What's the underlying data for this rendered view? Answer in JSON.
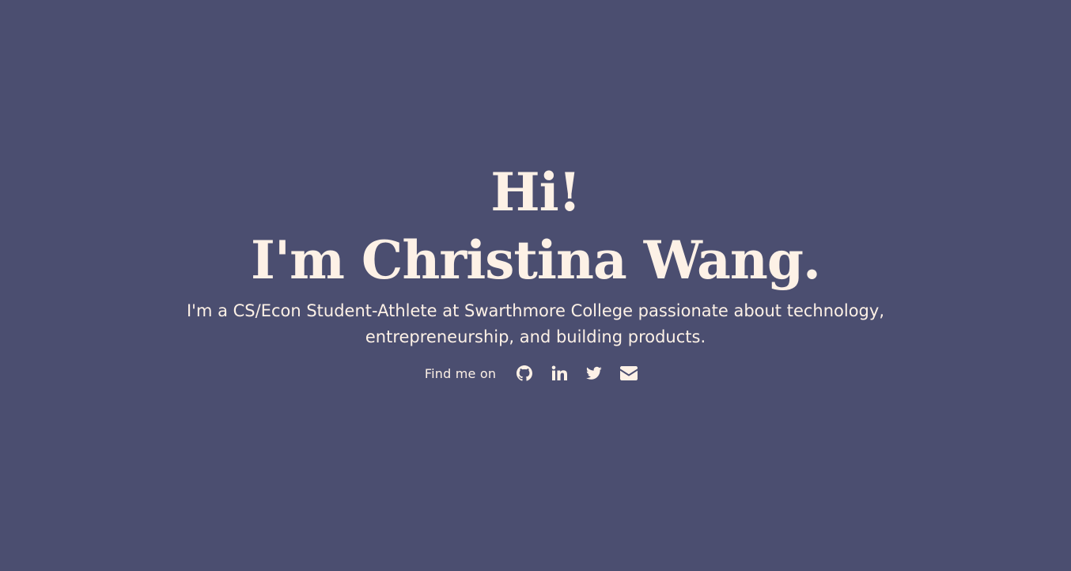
{
  "hero": {
    "greeting": "Hi!",
    "name": "I'm Christina Wang.",
    "tagline": "I'm a CS/Econ Student-Athlete at Swarthmore College passionate about technology, entrepreneurship, and building products."
  },
  "social": {
    "label": "Find me on",
    "links": [
      {
        "icon": "github-icon"
      },
      {
        "icon": "linkedin-icon"
      },
      {
        "icon": "twitter-icon"
      },
      {
        "icon": "envelope-icon"
      }
    ]
  },
  "colors": {
    "background": "#4b4e70",
    "text": "#fdf1e6"
  }
}
